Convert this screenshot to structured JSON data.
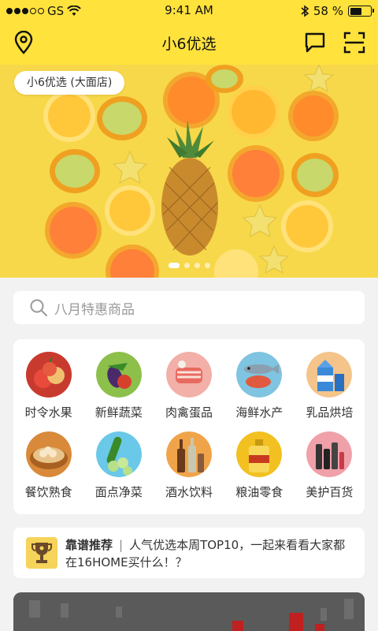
{
  "status_bar": {
    "carrier": "GS",
    "time": "9:41 AM",
    "battery": "58 %",
    "battery_level": 0.58
  },
  "nav": {
    "title": "小6优选",
    "icons": [
      "location-icon",
      "message-icon",
      "scan-icon"
    ]
  },
  "banner": {
    "store_name": "小6优选 (大面店)",
    "slide_count": 4,
    "active_slide": 1
  },
  "search": {
    "placeholder": "八月特惠商品"
  },
  "categories": [
    {
      "label": "时令水果",
      "icon": "fruit-icon"
    },
    {
      "label": "新鲜蔬菜",
      "icon": "vegetable-icon"
    },
    {
      "label": "肉禽蛋品",
      "icon": "meat-icon"
    },
    {
      "label": "海鲜水产",
      "icon": "seafood-icon"
    },
    {
      "label": "乳品烘培",
      "icon": "dairy-icon"
    },
    {
      "label": "餐饮熟食",
      "icon": "dumpling-icon"
    },
    {
      "label": "面点净菜",
      "icon": "cucumber-icon"
    },
    {
      "label": "酒水饮料",
      "icon": "drinks-icon"
    },
    {
      "label": "粮油零食",
      "icon": "oil-icon"
    },
    {
      "label": "美护百货",
      "icon": "cosmetics-icon"
    }
  ],
  "recommend": {
    "title": "靠谱推荐",
    "separator": "|",
    "text": "人气优选本周TOP10，一起来看看大家都在16HOME买什么！？"
  },
  "colors": {
    "brand_yellow": "#ffe23c",
    "background": "#f2f2f2"
  }
}
